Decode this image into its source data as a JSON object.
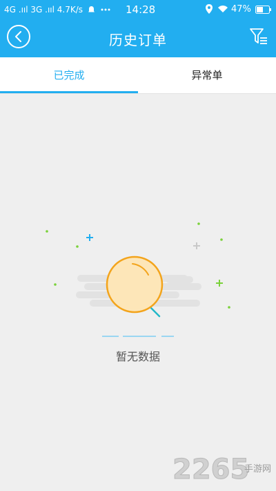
{
  "status_bar": {
    "left": "4G .ııl 3G .ııl 4.7K/s",
    "time": "14:28",
    "battery": "47%"
  },
  "header": {
    "title": "历史订单",
    "back_icon": "back-arrow-circle-icon",
    "filter_icon": "filter-funnel-icon"
  },
  "tabs": [
    {
      "label": "已完成",
      "active": true
    },
    {
      "label": "异常单",
      "active": false
    }
  ],
  "empty_state": {
    "text": "暂无数据",
    "icon": "magnifier-icon"
  },
  "colors": {
    "primary": "#22aef0",
    "background": "#efefef",
    "magnifier_fill": "#fde6b8",
    "magnifier_ring": "#f3a41c",
    "dot_green": "#7ad13a"
  },
  "watermark": {
    "number": "2265",
    "sub": "手游网"
  }
}
